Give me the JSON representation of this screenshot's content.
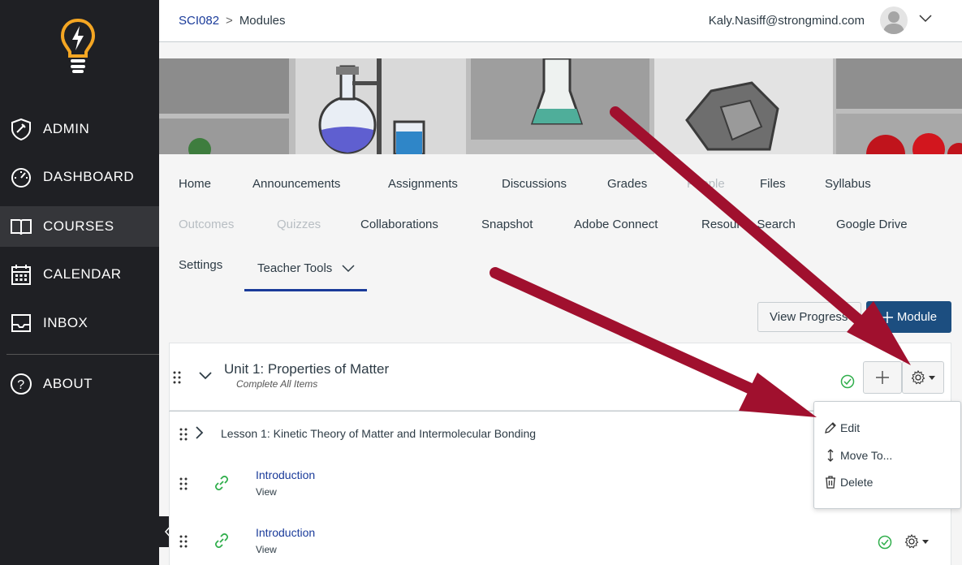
{
  "nav": {
    "items": [
      {
        "label": "ADMIN",
        "icon": "admin-shield-icon"
      },
      {
        "label": "DASHBOARD",
        "icon": "dashboard-gauge-icon"
      },
      {
        "label": "COURSES",
        "icon": "book-icon"
      },
      {
        "label": "CALENDAR",
        "icon": "calendar-icon"
      },
      {
        "label": "INBOX",
        "icon": "inbox-icon"
      },
      {
        "label": "ABOUT",
        "icon": "help-icon"
      }
    ]
  },
  "header": {
    "course": "SCI082",
    "separator": ">",
    "page": "Modules",
    "user_email": "Kaly.Nasiff@strongmind.com"
  },
  "course_nav": {
    "row1": [
      "Home",
      "Announcements",
      "Assignments",
      "Discussions",
      "Grades",
      "People",
      "Files",
      "Syllabus"
    ],
    "row2": [
      "Outcomes",
      "Quizzes",
      "Collaborations",
      "Snapshot",
      "Adobe Connect",
      "Resource Search",
      "Google Drive"
    ],
    "row3": [
      "Settings",
      "Teacher Tools"
    ]
  },
  "toolbar": {
    "view_progress": "View Progress",
    "add_module": "Module"
  },
  "module": {
    "title": "Unit 1: Properties of Matter",
    "requirement": "Complete All Items",
    "lesson": "Lesson 1: Kinetic Theory of Matter and Intermolecular Bonding",
    "items": [
      {
        "title": "Introduction",
        "sub": "View"
      },
      {
        "title": "Introduction",
        "sub": "View"
      }
    ]
  },
  "menu": {
    "edit": "Edit",
    "move": "Move To...",
    "delete": "Delete"
  },
  "colors": {
    "sidebar": "#1f2024",
    "accent": "#1a3b9a",
    "primary_button": "#1c4e80",
    "arrow": "#a0102e",
    "success": "#2fae4b"
  }
}
